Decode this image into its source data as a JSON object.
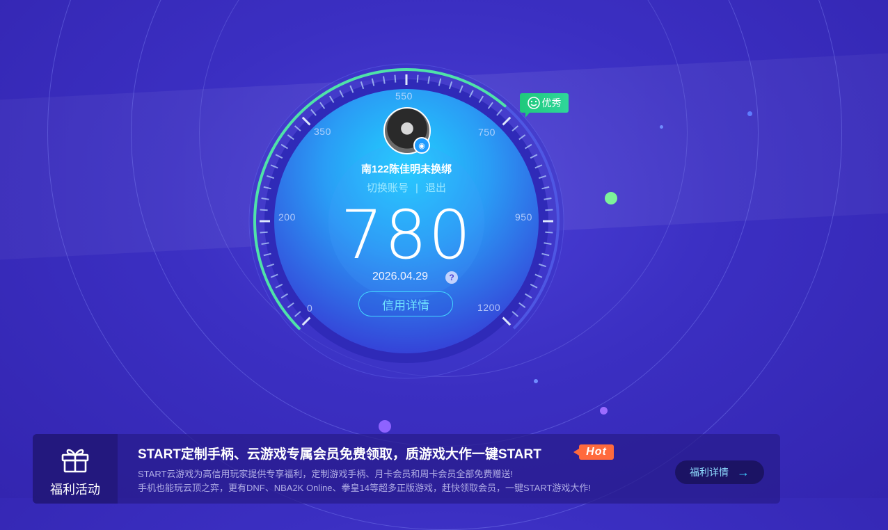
{
  "gauge": {
    "scale_labels": [
      "0",
      "200",
      "350",
      "550",
      "750",
      "950",
      "1200"
    ],
    "score": "780",
    "date": "2026.04.29",
    "rating_badge": "优秀",
    "detail_button": "信用详情",
    "accent_color": "#4fe3a8",
    "score_fraction": 0.65
  },
  "user": {
    "name": "南122陈佳明未换绑",
    "switch_account": "切换账号",
    "separator": "|",
    "logout": "退出"
  },
  "icons": {
    "help": "question-icon",
    "qq_badge": "qq-icon",
    "badge": "smile-icon",
    "gift": "gift-icon",
    "arrow": "arrow-right-icon"
  },
  "promo": {
    "section_label": "福利活动",
    "title": "START定制手柄、云游戏专属会员免费领取，质游戏大作一键START",
    "hot": "Hot",
    "desc_line1": "START云游戏为高信用玩家提供专享福利，定制游戏手柄、月卡会员和周卡会员全部免费赠送!",
    "desc_line2": "手机也能玩云顶之弈，更有DNF、NBA2K Online、拳皇14等超多正版游戏，赶快领取会员，一键START游戏大作!",
    "details_button": "福利详情"
  }
}
